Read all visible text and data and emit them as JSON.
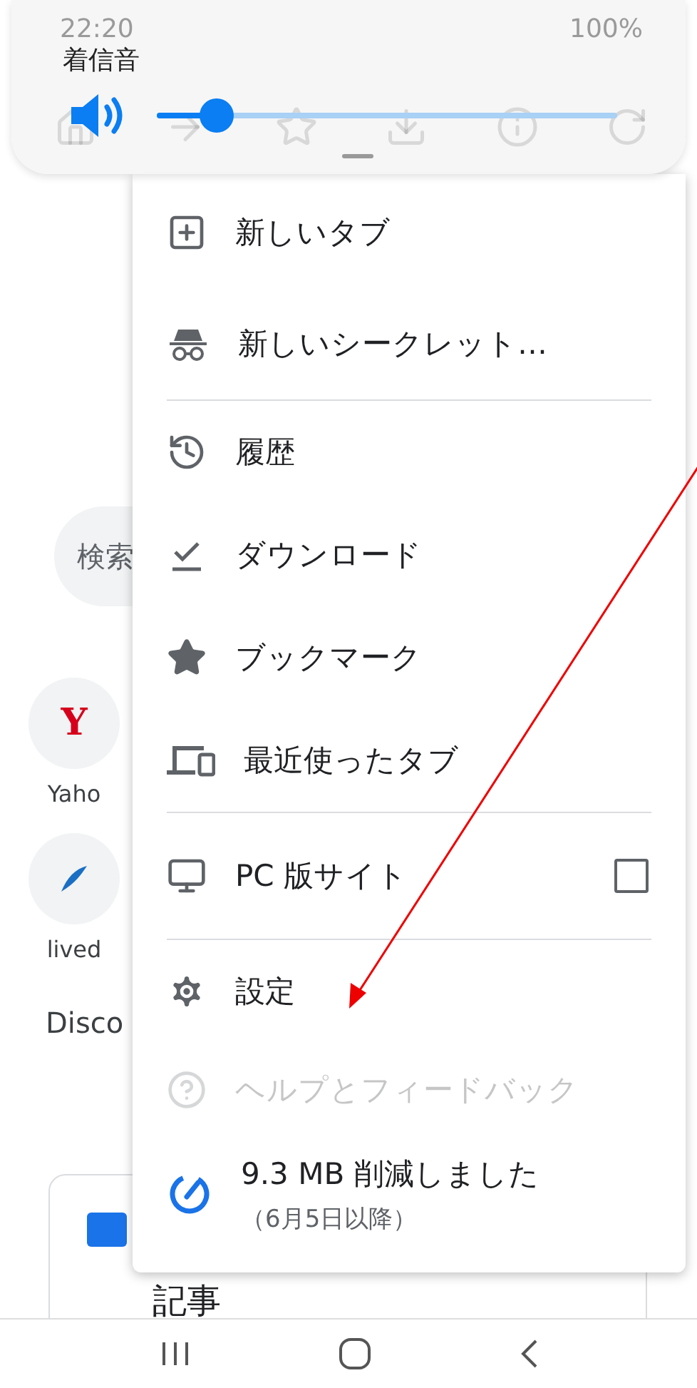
{
  "status_bar": {
    "time": "22:20",
    "battery": "100%"
  },
  "volume_panel": {
    "label": "着信音",
    "level": 0.13
  },
  "page": {
    "search_placeholder": "検索",
    "shortcuts": [
      {
        "label": "Yaho",
        "glyph": "Y"
      },
      {
        "label": "lived"
      }
    ],
    "section_title": "Disco",
    "card_title": "記事"
  },
  "menu": {
    "items": [
      {
        "kind": "item",
        "label": "新しいタブ"
      },
      {
        "kind": "item",
        "label": "新しいシークレット…"
      },
      {
        "kind": "divider"
      },
      {
        "kind": "item",
        "label": "履歴"
      },
      {
        "kind": "item",
        "label": "ダウンロード"
      },
      {
        "kind": "item",
        "label": "ブックマーク"
      },
      {
        "kind": "item",
        "label": "最近使ったタブ"
      },
      {
        "kind": "divider"
      },
      {
        "kind": "checkbox",
        "label": "PC 版サイト",
        "checked": false
      },
      {
        "kind": "divider"
      },
      {
        "kind": "item",
        "label": "設定"
      },
      {
        "kind": "faded",
        "label": "ヘルプとフィードバック"
      },
      {
        "kind": "saver",
        "label": "9.3 MB 削減しました",
        "sublabel": "（6月5日以降）"
      }
    ]
  },
  "nav_bar": {
    "buttons": [
      {
        "kind": "recent"
      },
      {
        "kind": "home"
      },
      {
        "kind": "back"
      }
    ]
  }
}
